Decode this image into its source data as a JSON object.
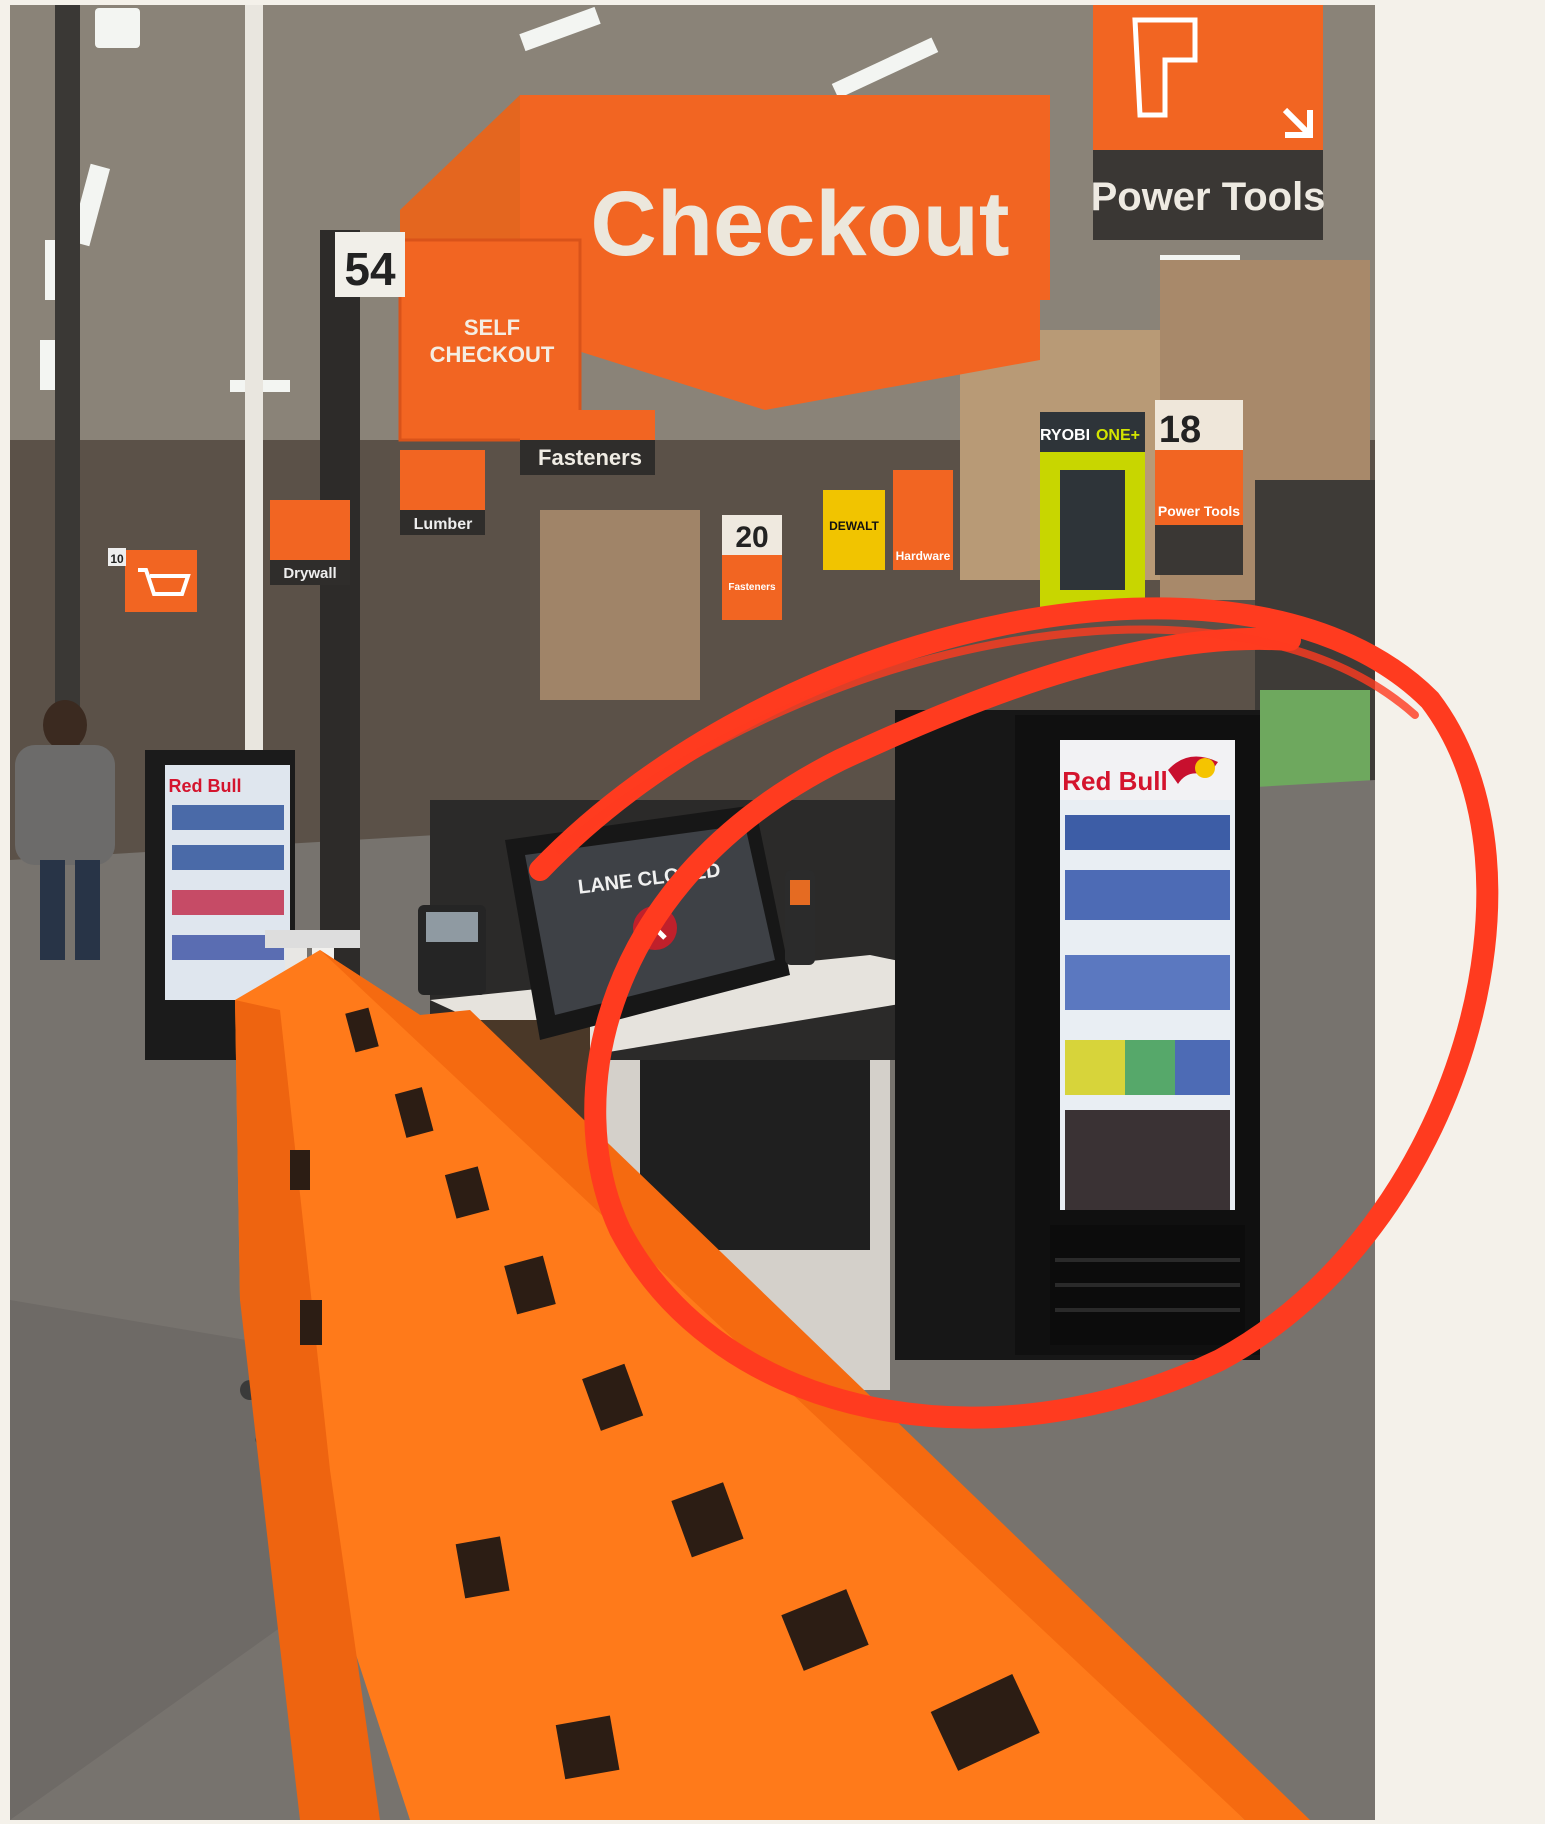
{
  "signs": {
    "checkout": "Checkout",
    "self_checkout_line1": "SELF",
    "self_checkout_line2": "CHECKOUT",
    "power_tools_main": "Power Tools",
    "power_tools_aisle": "Power Tools",
    "aisle_54": "54",
    "aisle_18": "18",
    "aisle_20": "20",
    "aisle_10": "10",
    "fasteners_overhead": "Fasteners",
    "fasteners_aisle": "Fasteners",
    "lumber": "Lumber",
    "drywall": "Drywall",
    "hardware": "Hardware",
    "ryobi": "RYOBI",
    "ryobi_one": "ONE+",
    "dewalt": "DEWALT"
  },
  "screen": {
    "lane_status": "LANE CLOSED"
  },
  "coolers": {
    "brand": "Red Bull"
  },
  "annotation": {
    "highlight_color": "#ff3b1f"
  },
  "colors": {
    "brand_orange": "#f26522",
    "barrier_orange": "#ff7a1a",
    "background": "#f4f1ea"
  }
}
